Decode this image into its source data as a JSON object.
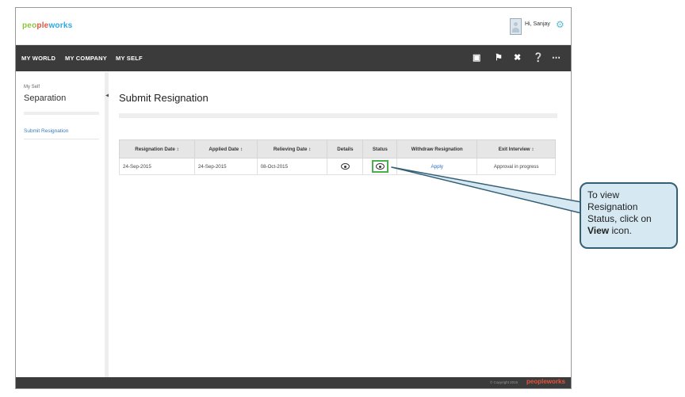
{
  "app": {
    "logo_text_1": "peo",
    "logo_text_2": "ple",
    "logo_text_3": "works",
    "greeting": "Hi, Sanjay"
  },
  "nav": {
    "items": [
      "MY WORLD",
      "MY COMPANY",
      "MY SELF"
    ],
    "icons": [
      "book-icon",
      "flag-icon",
      "tools-icon",
      "help-icon",
      "share-icon"
    ]
  },
  "sidebar": {
    "breadcrumb": "My Self",
    "section_title": "Separation",
    "link": "Submit Resignation"
  },
  "main": {
    "page_title": "Submit Resignation",
    "table": {
      "columns": [
        "Resignation Date ↕",
        "Applied Date ↕",
        "Relieving Date ↕",
        "Details",
        "Status",
        "Withdraw Resignation",
        "Exit Interview ↕"
      ],
      "rows": [
        {
          "resignation_date": "24-Sep-2015",
          "applied_date": "24-Sep-2015",
          "relieving_date": "08-Oct-2015",
          "withdraw": "Apply",
          "exit_interview": "Approval in progress"
        }
      ]
    }
  },
  "footer": {
    "copyright": "© Copyright 2015",
    "logo": "peopleworks"
  },
  "callout": {
    "line1": "To view Resignation Status, click on",
    "bold": "View",
    "line2": " icon."
  },
  "colors": {
    "nav_bg": "#3b3b3b",
    "accent_blue": "#3a7bbf",
    "highlight_green": "#4caf50",
    "callout_bg": "#d6e8f2"
  }
}
